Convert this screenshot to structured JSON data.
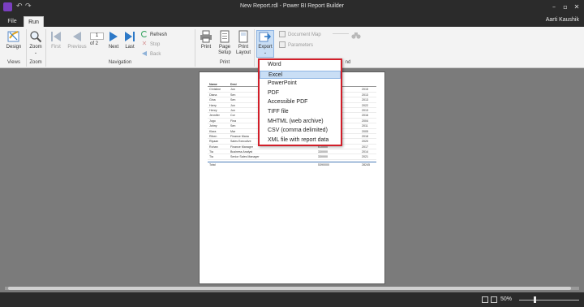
{
  "window": {
    "title": "New Report.rdl - Power BI Report Builder"
  },
  "tabs": [
    {
      "label": "File"
    },
    {
      "label": "Run"
    }
  ],
  "user": "Aarti Kaushik",
  "ribbon": {
    "views": {
      "design_label": "Design",
      "group_label": "Views"
    },
    "zoom": {
      "zoom_label": "Zoom",
      "group_label": "Zoom"
    },
    "navigation": {
      "first_label": "First",
      "previous_label": "Previous",
      "page_value": "1",
      "of_pages": "of 2",
      "next_label": "Next",
      "last_label": "Last",
      "refresh_label": "Refresh",
      "stop_label": "Stop",
      "back_label": "Back",
      "group_label": "Navigation"
    },
    "print": {
      "print_label": "Print",
      "page_setup_line1": "Page",
      "page_setup_line2": "Setup",
      "print_layout_line1": "Print",
      "print_layout_line2": "Layout",
      "group_label": "Print"
    },
    "export": {
      "export_label": "Export",
      "document_map_label": "Document Map",
      "parameters_label": "Parameters"
    },
    "find_group_label_fragment": "nd"
  },
  "export_menu": {
    "items": [
      "Word",
      "Excel",
      "PowerPoint",
      "PDF",
      "Accessible PDF",
      "TIFF file",
      "MHTML (web archive)",
      "CSV (comma delimited)",
      "XML file with report data"
    ],
    "selected_index": 1
  },
  "report": {
    "header": [
      "Name",
      "Desi",
      "",
      ""
    ],
    "rows": [
      [
        "Christine",
        "Jun",
        "",
        "2015"
      ],
      [
        "Diana",
        "Sen",
        "",
        "2013"
      ],
      [
        "Gina",
        "Sen",
        "",
        "2013"
      ],
      [
        "Harry",
        "Jun",
        "",
        "2022"
      ],
      [
        "Henry",
        "Jun",
        "",
        "2013"
      ],
      [
        "Jennifer",
        "Cor",
        "",
        "2016"
      ],
      [
        "Jugo",
        "Fina",
        "",
        "2004"
      ],
      [
        "Johny",
        "Sen",
        "",
        "2011"
      ],
      [
        "Klara",
        "Mar",
        "",
        "2005"
      ],
      [
        "Rihen",
        "Finance Mana",
        "",
        "2018"
      ],
      [
        "Riyaan",
        "Sales Executive",
        "330000",
        "2020"
      ],
      [
        "Rohan",
        "Finance Manager",
        "610000",
        "2017"
      ],
      [
        "Tia",
        "Business Analyst",
        "330000",
        "2014"
      ],
      [
        "Tia",
        "Senior Sales Manager",
        "330000",
        "2021"
      ]
    ],
    "total": [
      "Total",
      "",
      "5390000",
      "28245"
    ]
  },
  "status": {
    "zoom": "50%"
  },
  "colors": {
    "chrome_dark": "#2b2b2b",
    "ribbon_bg": "#f3f3f3",
    "workspace": "#7b7b7b",
    "menu_highlight": "#c9def5",
    "menu_border_red": "#d21f2a",
    "nav_blue": "#2d79c7"
  }
}
